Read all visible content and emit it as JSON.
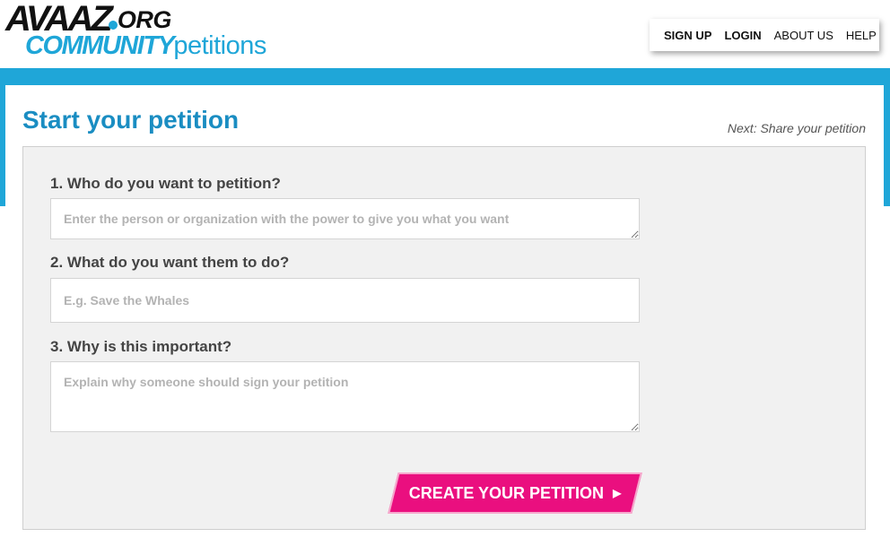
{
  "brand": {
    "avaaz": "AVAAZ",
    "org": "ORG",
    "community": "COMMUNITY",
    "petitions": "petitions"
  },
  "nav": {
    "items": [
      {
        "label": "SIGN UP"
      },
      {
        "label": "LOGIN"
      },
      {
        "label": "ABOUT US"
      },
      {
        "label": "HELP"
      }
    ]
  },
  "page": {
    "title": "Start your petition",
    "next_step": "Next: Share your petition"
  },
  "form": {
    "questions": [
      {
        "label": "1. Who do you want to petition?",
        "placeholder": "Enter the person or organization with the power to give you what you want",
        "value": ""
      },
      {
        "label": "2. What do you want them to do?",
        "placeholder": "E.g. Save the Whales",
        "value": ""
      },
      {
        "label": "3. Why is this important?",
        "placeholder": "Explain why someone should sign your petition",
        "value": ""
      }
    ],
    "submit_label": "CREATE YOUR PETITION",
    "submit_arrow": "▶"
  },
  "colors": {
    "brand_blue": "#1fa6d8",
    "title_blue": "#1a8dc2",
    "cta_pink": "#ea0f7f",
    "panel_gray": "#f1f1f1"
  },
  "icons": {
    "submit": "arrow-right-icon",
    "logo_dot": "dot-icon"
  }
}
